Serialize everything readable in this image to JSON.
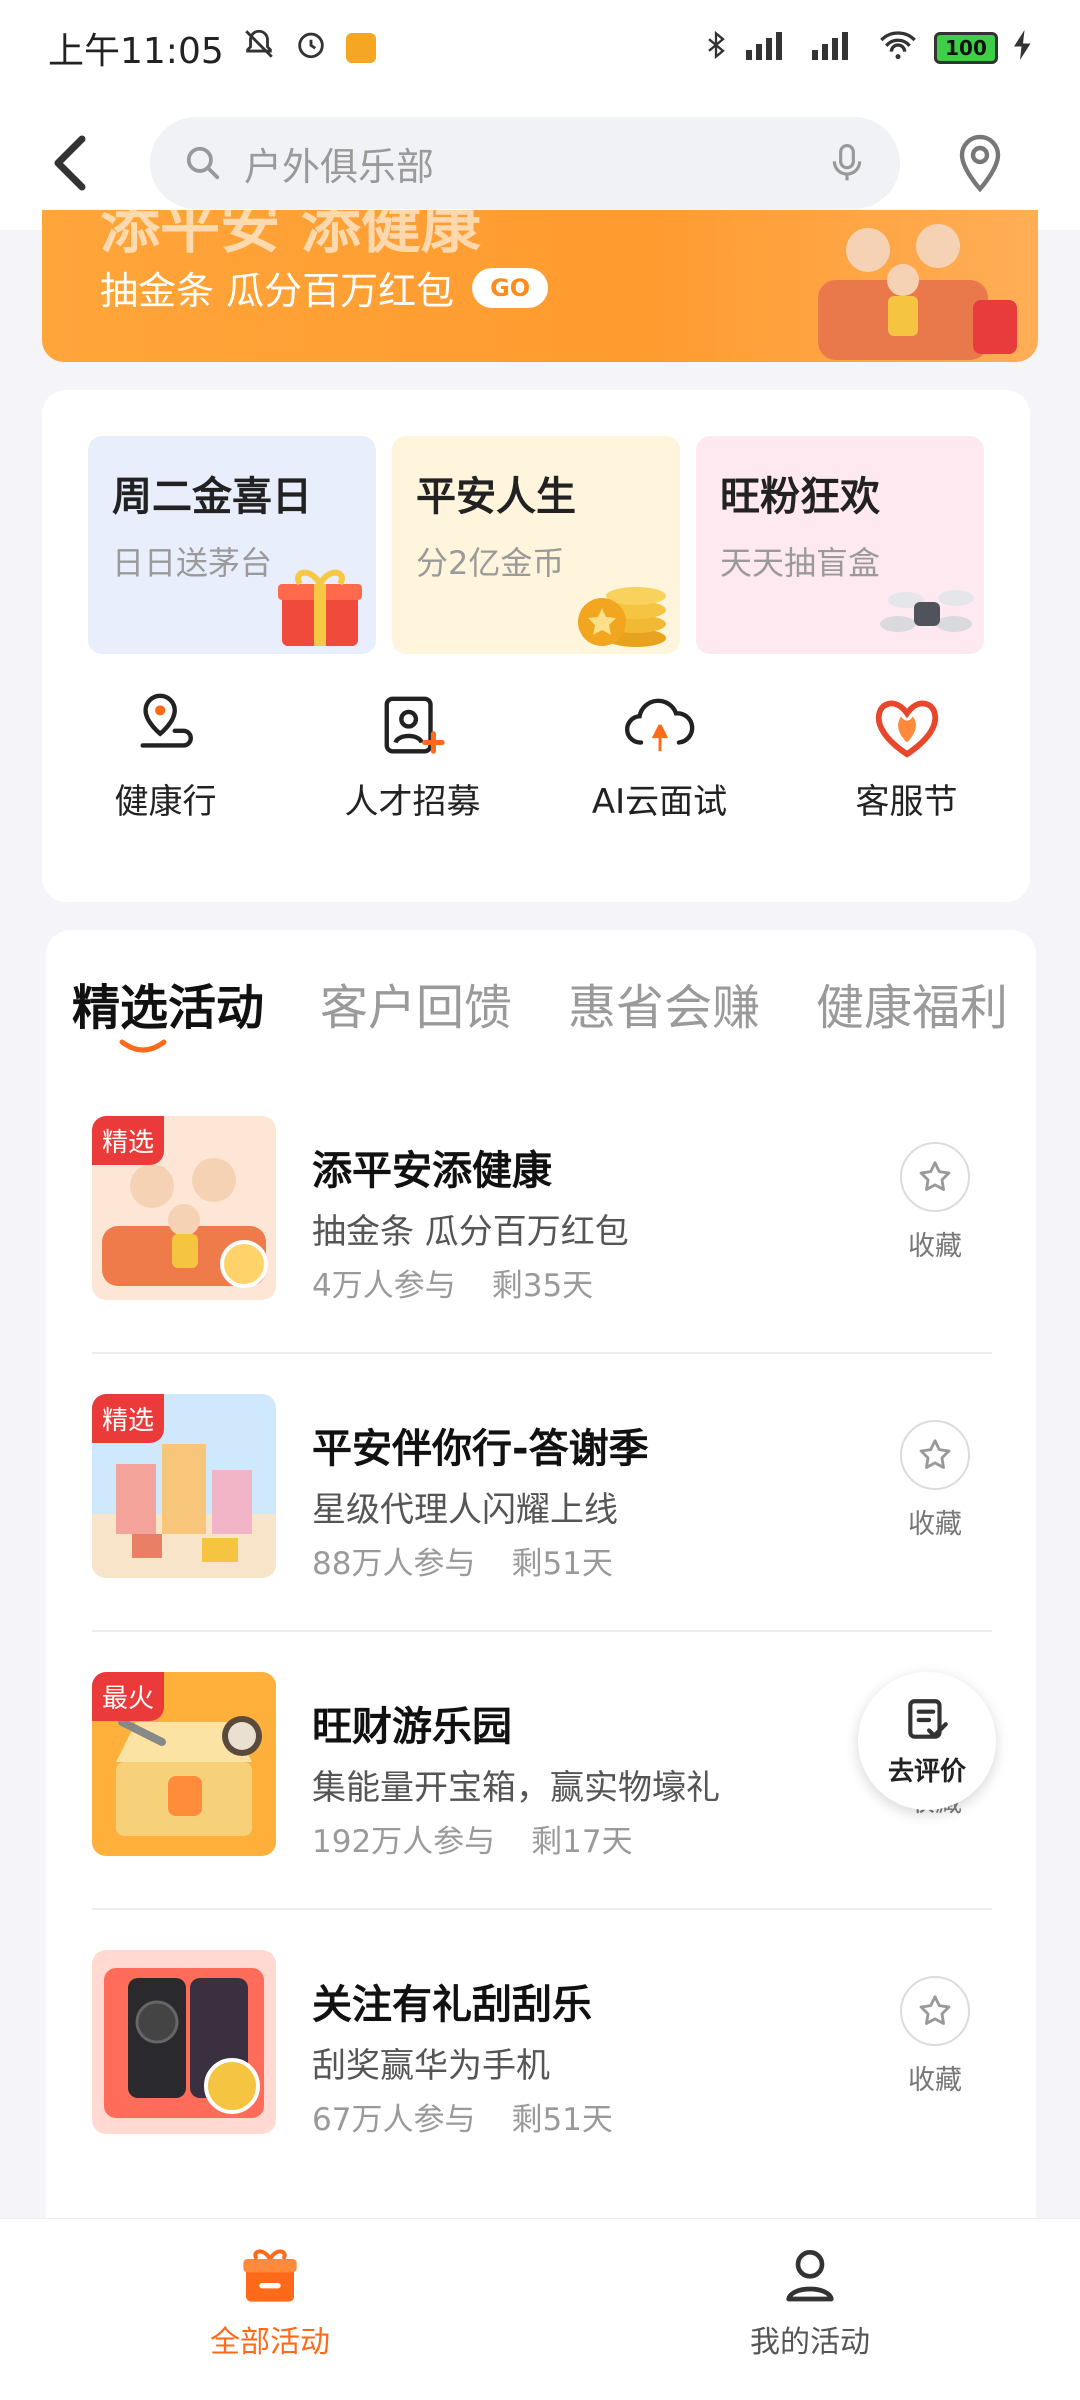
{
  "status_bar": {
    "time": "上午11:05",
    "battery": "100"
  },
  "header": {
    "search_placeholder": "户外俱乐部"
  },
  "banner": {
    "title_partial": "添平安 添健康",
    "subtitle": "抽金条 瓜分百万红包",
    "go_label": "GO"
  },
  "promos": [
    {
      "title": "周二金喜日",
      "subtitle": "日日送茅台"
    },
    {
      "title": "平安人生",
      "subtitle": "分2亿金币"
    },
    {
      "title": "旺粉狂欢",
      "subtitle": "天天抽盲盒"
    }
  ],
  "quick_links": [
    {
      "label": "健康行"
    },
    {
      "label": "人才招募"
    },
    {
      "label": "AI云面试"
    },
    {
      "label": "客服节"
    }
  ],
  "tabs": [
    {
      "label": "精选活动",
      "active": true
    },
    {
      "label": "客户回馈"
    },
    {
      "label": "惠省会赚"
    },
    {
      "label": "健康福利"
    }
  ],
  "activities": [
    {
      "tag": "精选",
      "title": "添平安添健康",
      "subtitle": "抽金条 瓜分百万红包",
      "participants": "4万人参与",
      "remaining": "剩35天",
      "fav_label": "收藏"
    },
    {
      "tag": "精选",
      "title": "平安伴你行-答谢季",
      "subtitle": "星级代理人闪耀上线",
      "participants": "88万人参与",
      "remaining": "剩51天",
      "fav_label": "收藏"
    },
    {
      "tag": "最火",
      "title": "旺财游乐园",
      "subtitle": "集能量开宝箱，赢实物壕礼",
      "participants": "192万人参与",
      "remaining": "剩17天",
      "fav_label": "收藏"
    },
    {
      "tag": "",
      "title": "关注有礼刮刮乐",
      "subtitle": "刮奖赢华为手机",
      "participants": "67万人参与",
      "remaining": "剩51天",
      "fav_label": "收藏"
    }
  ],
  "floating": {
    "evaluate_label": "去评价"
  },
  "bottom_nav": [
    {
      "label": "全部活动",
      "active": true
    },
    {
      "label": "我的活动"
    }
  ],
  "colors": {
    "accent": "#ff6a1a",
    "banner": "#ffa53a",
    "tag_red": "#ea3a39"
  }
}
